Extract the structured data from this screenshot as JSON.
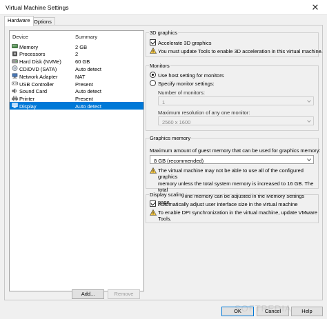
{
  "window": {
    "title": "Virtual Machine Settings"
  },
  "tabs": [
    {
      "label": "Hardware",
      "active": true
    },
    {
      "label": "Options",
      "active": false
    }
  ],
  "device_list": {
    "headers": {
      "device": "Device",
      "summary": "Summary"
    },
    "rows": [
      {
        "name": "Memory",
        "summary": "2 GB",
        "icon": "memory-icon",
        "selected": false
      },
      {
        "name": "Processors",
        "summary": "2",
        "icon": "processor-icon",
        "selected": false
      },
      {
        "name": "Hard Disk (NVMe)",
        "summary": "60 GB",
        "icon": "hard-disk-icon",
        "selected": false
      },
      {
        "name": "CD/DVD (SATA)",
        "summary": "Auto detect",
        "icon": "cd-dvd-icon",
        "selected": false
      },
      {
        "name": "Network Adapter",
        "summary": "NAT",
        "icon": "network-adapter-icon",
        "selected": false
      },
      {
        "name": "USB Controller",
        "summary": "Present",
        "icon": "usb-icon",
        "selected": false
      },
      {
        "name": "Sound Card",
        "summary": "Auto detect",
        "icon": "sound-card-icon",
        "selected": false
      },
      {
        "name": "Printer",
        "summary": "Present",
        "icon": "printer-icon",
        "selected": false
      },
      {
        "name": "Display",
        "summary": "Auto detect",
        "icon": "display-icon",
        "selected": true
      }
    ],
    "add_label": "Add...",
    "remove_label": "Remove"
  },
  "graphics3d": {
    "legend": "3D graphics",
    "accelerate_label": "Accelerate 3D graphics",
    "accelerate_checked": true,
    "warning": "You must update Tools to enable 3D acceleration in this virtual machine."
  },
  "monitors": {
    "legend": "Monitors",
    "use_host_label": "Use host setting for monitors",
    "specify_label": "Specify monitor settings:",
    "selected": "use_host",
    "num_label": "Number of monitors:",
    "num_value": "1",
    "maxres_label": "Maximum resolution of any one monitor:",
    "maxres_value": "2560 x 1600"
  },
  "graphics_memory": {
    "legend": "Graphics memory",
    "desc": "Maximum amount of guest memory that can be used for graphics memory:",
    "value": "8 GB (recommended)",
    "warning_lines": [
      "The virtual machine may not be able to use all of the configured graphics",
      "memory unless the total system memory is increased to 16 GB. The total",
      "virtual machine memory can be adjusted in the Memory settings page."
    ]
  },
  "display_scaling": {
    "legend": "Display scaling",
    "auto_label": "Automatically adjust user interface size in the virtual machine",
    "auto_checked": true,
    "warning_lines": [
      "To enable DPI synchronization in the virtual machine, update VMware",
      "Tools."
    ]
  },
  "footer": {
    "ok": "OK",
    "cancel": "Cancel",
    "help": "Help"
  },
  "watermark": "SOFTPEDIA",
  "colors": {
    "selection": "#0078d7",
    "warning": "#f7c948"
  }
}
